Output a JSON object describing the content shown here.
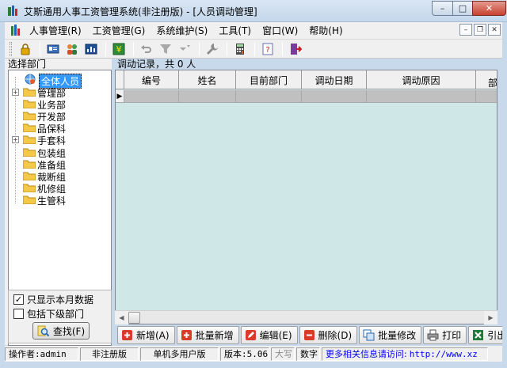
{
  "window": {
    "title": "艾斯通用人事工资管理系统(非注册版) - [人员调动管理]",
    "minimize": "–",
    "maximize": "□",
    "close": "✕"
  },
  "menubar": {
    "items": [
      "人事管理(R)",
      "工资管理(G)",
      "系统维护(S)",
      "工具(T)",
      "窗口(W)",
      "帮助(H)"
    ],
    "mdi_min": "–",
    "mdi_restore": "❐",
    "mdi_close": "✕"
  },
  "toolbar": {
    "icons": [
      "lock-icon",
      "card-icon",
      "people-icon",
      "chart-icon",
      "yen-icon",
      "undo-icon",
      "filter-icon",
      "filter-dropdown-icon",
      "wrench-icon",
      "calculator-icon",
      "help-icon",
      "exit-icon"
    ]
  },
  "left_panel": {
    "title": "选择部门",
    "tree": [
      {
        "label": "全体人员",
        "selected": true,
        "level": 0,
        "expander": ""
      },
      {
        "label": "管理部",
        "level": 1,
        "expander": "+"
      },
      {
        "label": "业务部",
        "level": 1,
        "expander": ""
      },
      {
        "label": "开发部",
        "level": 1,
        "expander": ""
      },
      {
        "label": "品保科",
        "level": 1,
        "expander": ""
      },
      {
        "label": "手套科",
        "level": 1,
        "expander": "+"
      },
      {
        "label": "包装组",
        "level": 1,
        "expander": ""
      },
      {
        "label": "准备组",
        "level": 1,
        "expander": ""
      },
      {
        "label": "裁断组",
        "level": 1,
        "expander": ""
      },
      {
        "label": "机修组",
        "level": 1,
        "expander": ""
      },
      {
        "label": "生管科",
        "level": 1,
        "expander": ""
      }
    ],
    "chk_current_month": {
      "label": "只显示本月数据",
      "checked": true
    },
    "chk_sub_depts": {
      "label": "包括下级部门",
      "checked": false
    },
    "find_label": "查找(F)"
  },
  "main": {
    "record_label": "调动记录，共 0 人",
    "columns": [
      "编号",
      "姓名",
      "目前部门",
      "调动日期",
      "调动原因",
      "部"
    ],
    "row_indicator": "▶"
  },
  "actions": [
    {
      "label": "新增(A)",
      "icon": "add-icon"
    },
    {
      "label": "批量新增",
      "icon": "batch-add-icon"
    },
    {
      "label": "编辑(E)",
      "icon": "edit-icon"
    },
    {
      "label": "删除(D)",
      "icon": "delete-icon"
    },
    {
      "label": "批量修改",
      "icon": "batch-edit-icon"
    },
    {
      "label": "打印",
      "icon": "print-icon"
    },
    {
      "label": "引出",
      "icon": "export-icon"
    }
  ],
  "statusbar": {
    "operator": "操作者:admin",
    "edition": "非注册版",
    "mode": "单机多用户版",
    "version": "版本:5.06",
    "caps": "大写",
    "num": "数字",
    "link_text": "更多相关信息请访问:",
    "url": "http://www.xz"
  },
  "colors": {
    "grid_bg": "#cfe7e6",
    "selected_node": "#3399ff",
    "close_button": "#c7412f",
    "link": "#0000ff"
  }
}
